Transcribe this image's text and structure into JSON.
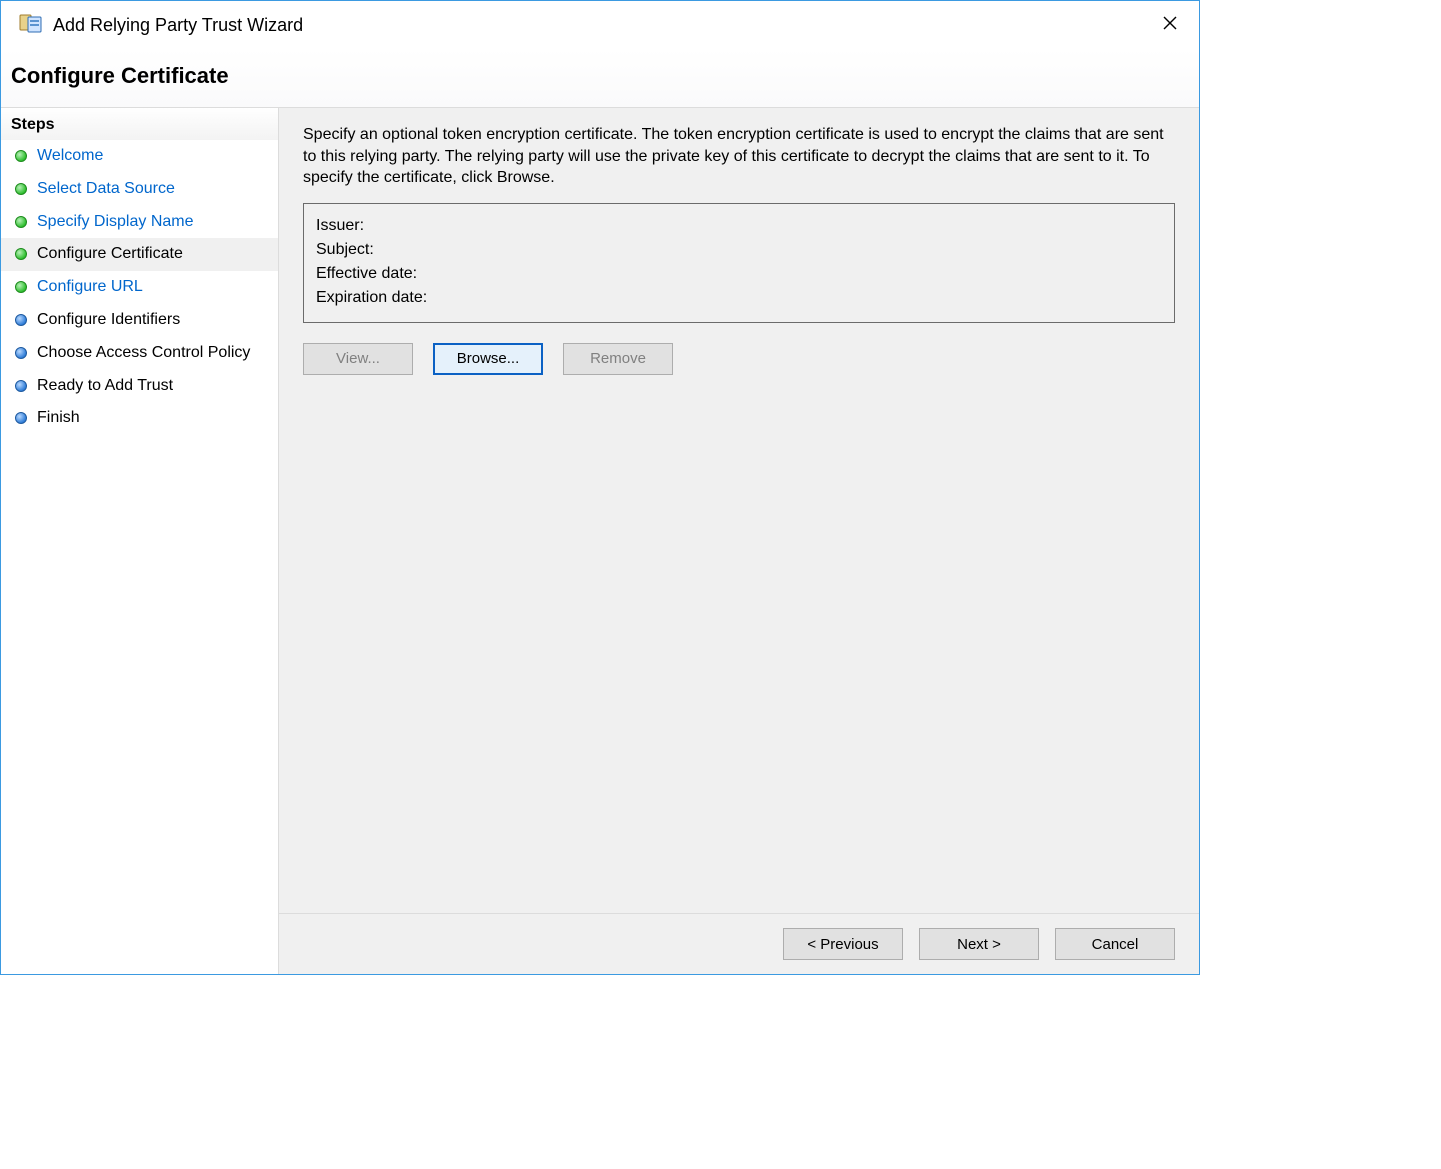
{
  "window": {
    "title": "Add Relying Party Trust Wizard"
  },
  "header": {
    "title": "Configure Certificate"
  },
  "sidebar": {
    "header": "Steps",
    "items": [
      {
        "label": "Welcome",
        "bullet": "green",
        "state": "link"
      },
      {
        "label": "Select Data Source",
        "bullet": "green",
        "state": "link"
      },
      {
        "label": "Specify Display Name",
        "bullet": "green",
        "state": "link"
      },
      {
        "label": "Configure Certificate",
        "bullet": "green",
        "state": "current"
      },
      {
        "label": "Configure URL",
        "bullet": "green",
        "state": "link"
      },
      {
        "label": "Configure Identifiers",
        "bullet": "blue",
        "state": "pending"
      },
      {
        "label": "Choose Access Control Policy",
        "bullet": "blue",
        "state": "pending"
      },
      {
        "label": "Ready to Add Trust",
        "bullet": "blue",
        "state": "pending"
      },
      {
        "label": "Finish",
        "bullet": "blue",
        "state": "pending"
      }
    ]
  },
  "main": {
    "description": "Specify an optional token encryption certificate.  The token encryption certificate is used to encrypt the claims that are sent to this relying party.  The relying party will use the private key of this certificate to decrypt the claims that are sent to it.  To specify the certificate, click Browse.",
    "cert": {
      "issuer_label": "Issuer:",
      "issuer_value": "",
      "subject_label": "Subject:",
      "subject_value": "",
      "effective_label": "Effective date:",
      "effective_value": "",
      "expiration_label": "Expiration date:",
      "expiration_value": ""
    },
    "buttons": {
      "view": "View...",
      "browse": "Browse...",
      "remove": "Remove"
    }
  },
  "footer": {
    "previous": "< Previous",
    "next": "Next >",
    "cancel": "Cancel"
  }
}
